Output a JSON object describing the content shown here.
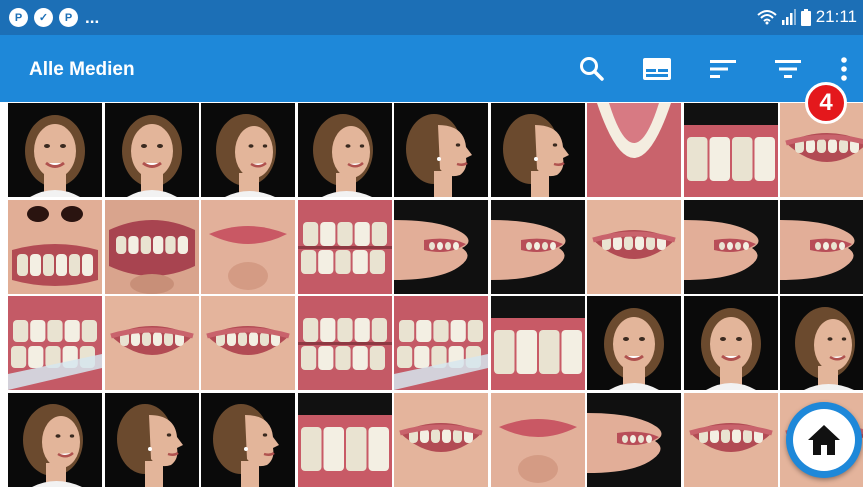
{
  "status_bar": {
    "notification_icons": [
      "p-badge-icon",
      "check-cloud-icon",
      "p-badge-icon"
    ],
    "overflow": "...",
    "time": "21:11",
    "system_icons": [
      "wifi-icon",
      "signal-icon",
      "battery-icon"
    ]
  },
  "app_bar": {
    "title": "Alle Medien",
    "actions": [
      "search-icon",
      "slideshow-icon",
      "sort-icon",
      "filter-icon",
      "more-vert-icon"
    ],
    "badge": "4"
  },
  "gallery": {
    "rows": [
      [
        "portrait-front",
        "portrait-front",
        "portrait-three-quarter",
        "portrait-three-quarter",
        "portrait-profile",
        "portrait-profile",
        "intraoral-occlusal",
        "front-teeth-closeup",
        "smile-closeup"
      ],
      [
        "intraoral-nose-view",
        "intraoral-inverted",
        "lips-inverted",
        "intraoral-lateral",
        "lips-profile",
        "lips-profile",
        "smile-closeup",
        "lips-profile",
        "lips-profile"
      ],
      [
        "intraoral-lateral-retractor",
        "smile-closeup",
        "smile-closeup",
        "intraoral-lateral",
        "intraoral-lateral-retractor",
        "front-teeth-closeup",
        "portrait-front",
        "portrait-front",
        "portrait-three-quarter"
      ],
      [
        "portrait-three-quarter",
        "portrait-profile",
        "portrait-profile",
        "front-teeth-closeup",
        "smile-closeup",
        "lips-inverted",
        "lips-profile",
        "smile-closeup",
        "smile-closeup"
      ]
    ]
  },
  "fab": {
    "icon": "home-icon"
  },
  "colors": {
    "status_bar": "#1c6fb6",
    "app_bar": "#1e88d9",
    "badge": "#e4181c",
    "fab_ring": "#1e88d9"
  }
}
